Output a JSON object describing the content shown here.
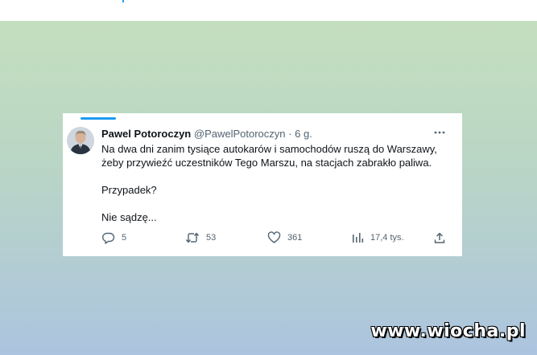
{
  "tweet": {
    "author": {
      "display_name": "Pawel Potoroczyn",
      "handle": "@PawelPotoroczyn",
      "separator": "·",
      "time": "6 g."
    },
    "text": {
      "line1": "Na dwa dni zanim tysiące autokarów i samochodów ruszą do Warszawy,",
      "line2": "żeby przywieźć uczestników Tego Marszu, na stacjach zabrakło paliwa.",
      "line3": "Przypadek?",
      "line4": "Nie sądzę..."
    },
    "actions": {
      "replies": "5",
      "retweets": "53",
      "likes": "361",
      "views": "17,4 tys."
    },
    "icons": {
      "more": "more-horizontal-icon",
      "reply": "reply-icon",
      "retweet": "retweet-icon",
      "like": "heart-icon",
      "views": "analytics-icon",
      "share": "share-icon"
    }
  },
  "watermark": "www.wiocha.pl",
  "colors": {
    "accent": "#1d9bf0",
    "text_primary": "#0f1419",
    "text_secondary": "#536471",
    "background_top": "#c5e0bd",
    "background_bottom": "#acc4df"
  }
}
